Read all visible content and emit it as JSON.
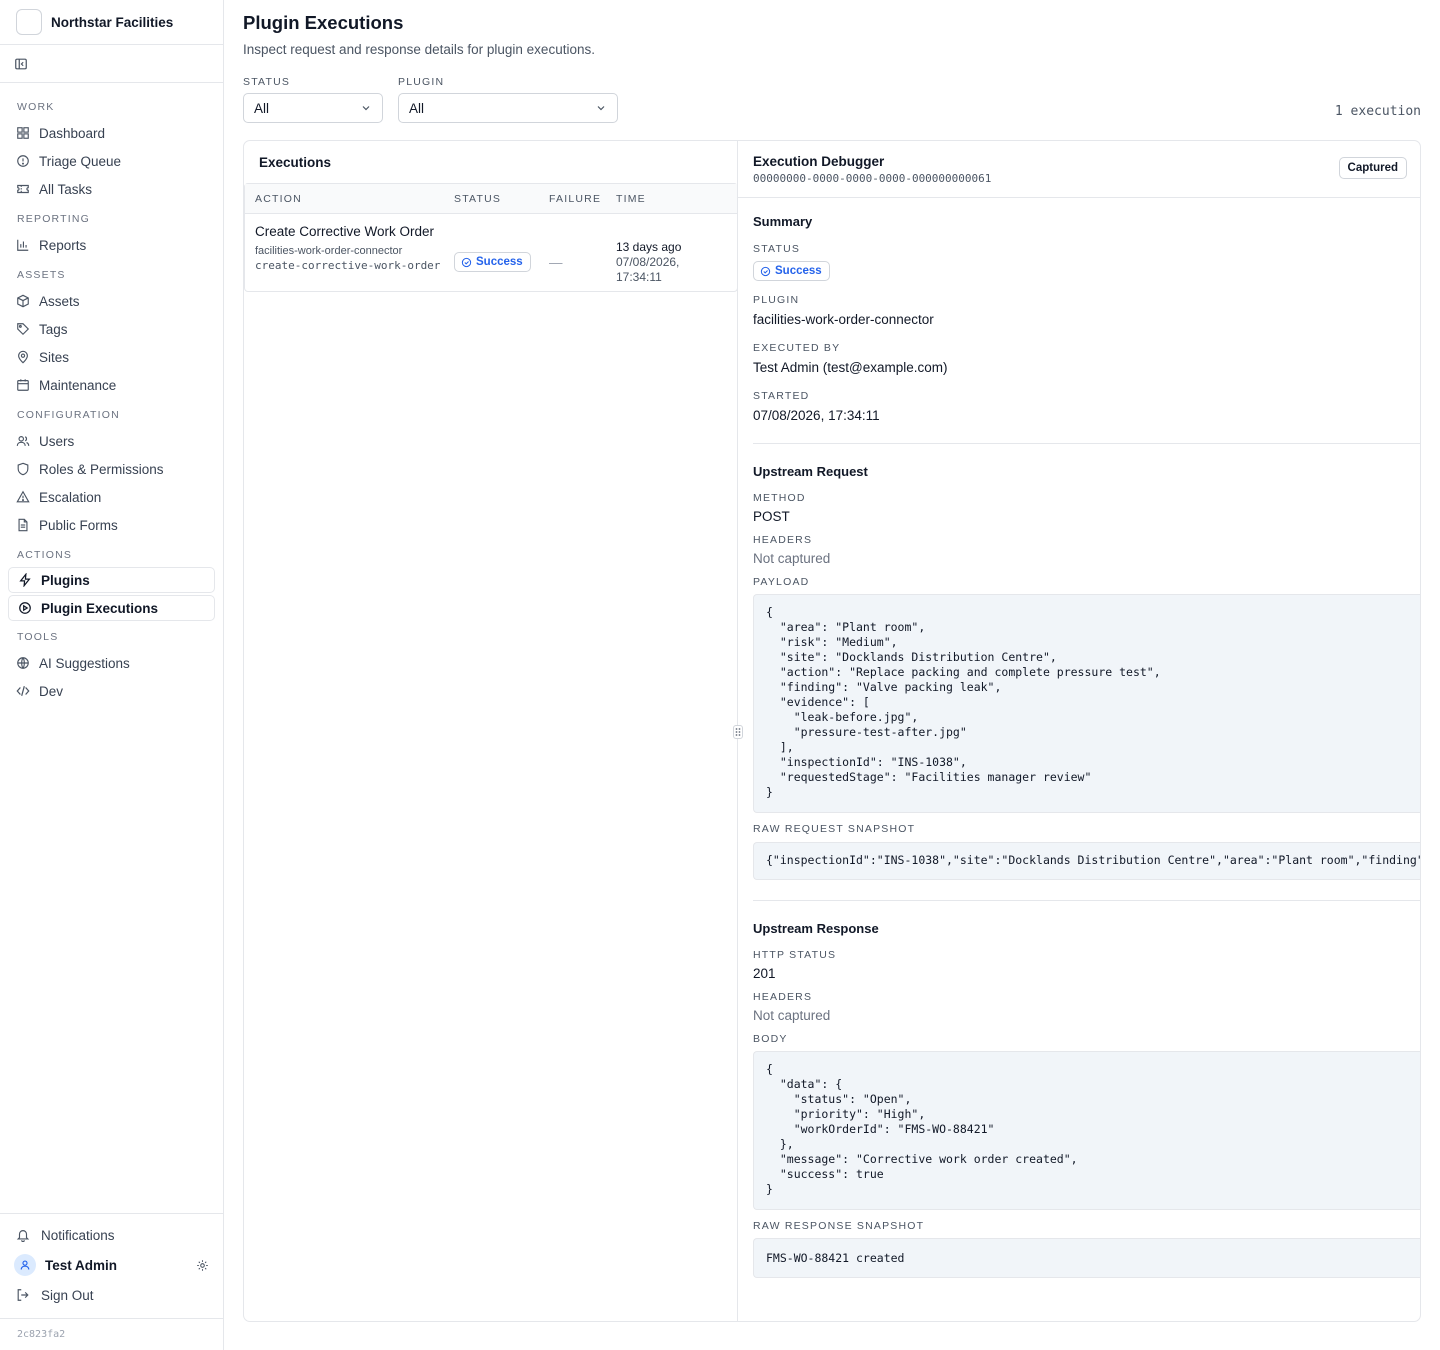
{
  "app": {
    "name": "Northstar Facilities",
    "version": "2c823fa2"
  },
  "sidebar": {
    "sections": [
      {
        "title": "WORK",
        "items": [
          {
            "label": "Dashboard",
            "icon": "grid-icon"
          },
          {
            "label": "Triage Queue",
            "icon": "alert-circle-icon"
          },
          {
            "label": "All Tasks",
            "icon": "ticket-icon"
          }
        ]
      },
      {
        "title": "REPORTING",
        "items": [
          {
            "label": "Reports",
            "icon": "bar-chart-icon"
          }
        ]
      },
      {
        "title": "ASSETS",
        "items": [
          {
            "label": "Assets",
            "icon": "box-icon"
          },
          {
            "label": "Tags",
            "icon": "tag-icon"
          },
          {
            "label": "Sites",
            "icon": "map-pin-icon"
          },
          {
            "label": "Maintenance",
            "icon": "calendar-icon"
          }
        ]
      },
      {
        "title": "CONFIGURATION",
        "items": [
          {
            "label": "Users",
            "icon": "users-icon"
          },
          {
            "label": "Roles & Permissions",
            "icon": "shield-icon"
          },
          {
            "label": "Escalation",
            "icon": "warning-icon"
          },
          {
            "label": "Public Forms",
            "icon": "file-text-icon"
          }
        ]
      },
      {
        "title": "ACTIONS",
        "items": [
          {
            "label": "Plugins",
            "icon": "zap-icon"
          },
          {
            "label": "Plugin Executions",
            "icon": "play-circle-icon"
          }
        ]
      },
      {
        "title": "TOOLS",
        "items": [
          {
            "label": "AI Suggestions",
            "icon": "sparkle-icon"
          },
          {
            "label": "Dev",
            "icon": "code-icon"
          }
        ]
      }
    ],
    "notifications": "Notifications",
    "user": "Test Admin",
    "sign_out": "Sign Out"
  },
  "page": {
    "title": "Plugin Executions",
    "subtitle": "Inspect request and response details for plugin executions.",
    "filters": {
      "status_label": "STATUS",
      "status_value": "All",
      "plugin_label": "PLUGIN",
      "plugin_value": "All"
    },
    "count": "1 execution"
  },
  "executions": {
    "title": "Executions",
    "columns": [
      "ACTION",
      "STATUS",
      "FAILURE",
      "TIME"
    ],
    "rows": [
      {
        "action": "Create Corrective Work Order",
        "plugin": "facilities-work-order-connector",
        "action_key": "create-corrective-work-order",
        "status": "Success",
        "failure": "—",
        "time_relative": "13 days ago",
        "time_absolute": "07/08/2026, 17:34:11"
      }
    ]
  },
  "debugger": {
    "title": "Execution Debugger",
    "id": "00000000-0000-0000-0000-000000000061",
    "badge": "Captured",
    "summary": {
      "title": "Summary",
      "status_label": "STATUS",
      "status": "Success",
      "plugin_label": "PLUGIN",
      "plugin": "facilities-work-order-connector",
      "executed_by_label": "EXECUTED BY",
      "executed_by": "Test Admin (test@example.com)",
      "started_label": "STARTED",
      "started": "07/08/2026, 17:34:11"
    },
    "request": {
      "title": "Upstream Request",
      "method_label": "METHOD",
      "method": "POST",
      "headers_label": "HEADERS",
      "headers": "Not captured",
      "payload_label": "PAYLOAD",
      "payload": "{\n  \"area\": \"Plant room\",\n  \"risk\": \"Medium\",\n  \"site\": \"Docklands Distribution Centre\",\n  \"action\": \"Replace packing and complete pressure test\",\n  \"finding\": \"Valve packing leak\",\n  \"evidence\": [\n    \"leak-before.jpg\",\n    \"pressure-test-after.jpg\"\n  ],\n  \"inspectionId\": \"INS-1038\",\n  \"requestedStage\": \"Facilities manager review\"\n}",
      "raw_label": "RAW REQUEST SNAPSHOT",
      "raw": "{\"inspectionId\":\"INS-1038\",\"site\":\"Docklands Distribution Centre\",\"area\":\"Plant room\",\"finding\""
    },
    "response": {
      "title": "Upstream Response",
      "http_label": "HTTP STATUS",
      "http": "201",
      "headers_label": "HEADERS",
      "headers": "Not captured",
      "body_label": "BODY",
      "body": "{\n  \"data\": {\n    \"status\": \"Open\",\n    \"priority\": \"High\",\n    \"workOrderId\": \"FMS-WO-88421\"\n  },\n  \"message\": \"Corrective work order created\",\n  \"success\": true\n}",
      "raw_label": "RAW RESPONSE SNAPSHOT",
      "raw": "FMS-WO-88421 created"
    }
  }
}
